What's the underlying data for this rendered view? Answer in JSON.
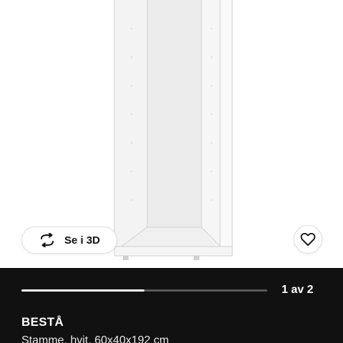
{
  "product": {
    "name": "BESTÅ",
    "description": "Stamme, hvit, 60x40x192 cm"
  },
  "actions": {
    "view_3d_label": "Se i 3D",
    "view_3d_icon": "rotate-3d-icon",
    "favorite_icon": "heart-outline-icon"
  },
  "gallery": {
    "page_indicator": "1 av 2",
    "current": 1,
    "total": 2,
    "progress": 0.5
  },
  "colors": {
    "panel_background": "#111111",
    "progress_fill": "#ffffff",
    "progress_track": "#5a5a5a",
    "cabinet": "#f4f4f4"
  }
}
